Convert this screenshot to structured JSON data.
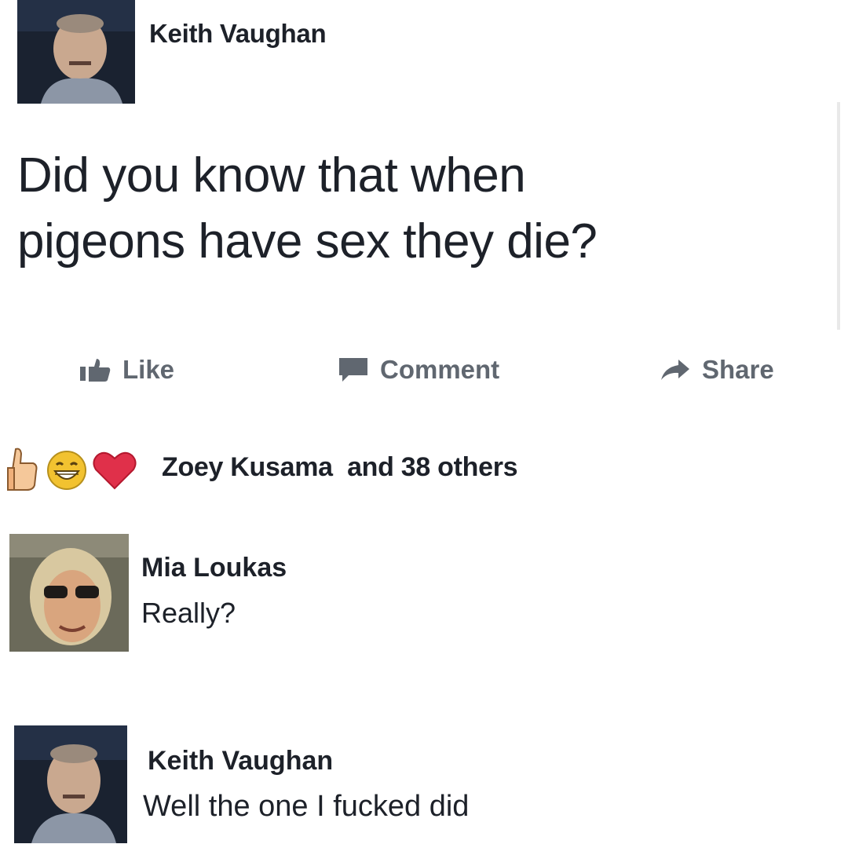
{
  "post": {
    "author_name": "Keith Vaughan",
    "text_line_1": "Did you know that when",
    "text_line_2": "pigeons have sex they die?"
  },
  "actions": {
    "like_label": "Like",
    "comment_label": "Comment",
    "share_label": "Share"
  },
  "reactions": {
    "icons": [
      "thumbs-up-icon",
      "laughing-face-icon",
      "heart-icon"
    ],
    "summary": "Zoey Kusama  and 38 others"
  },
  "comments": [
    {
      "author_name": "Mia Loukas",
      "text": "Really?"
    },
    {
      "author_name": "Keith Vaughan",
      "text": "Well the one I fucked did"
    }
  ],
  "colors": {
    "text": "#1d2129",
    "action_text": "#606770",
    "heart": "#e0304a",
    "laugh": "#f2c230"
  }
}
